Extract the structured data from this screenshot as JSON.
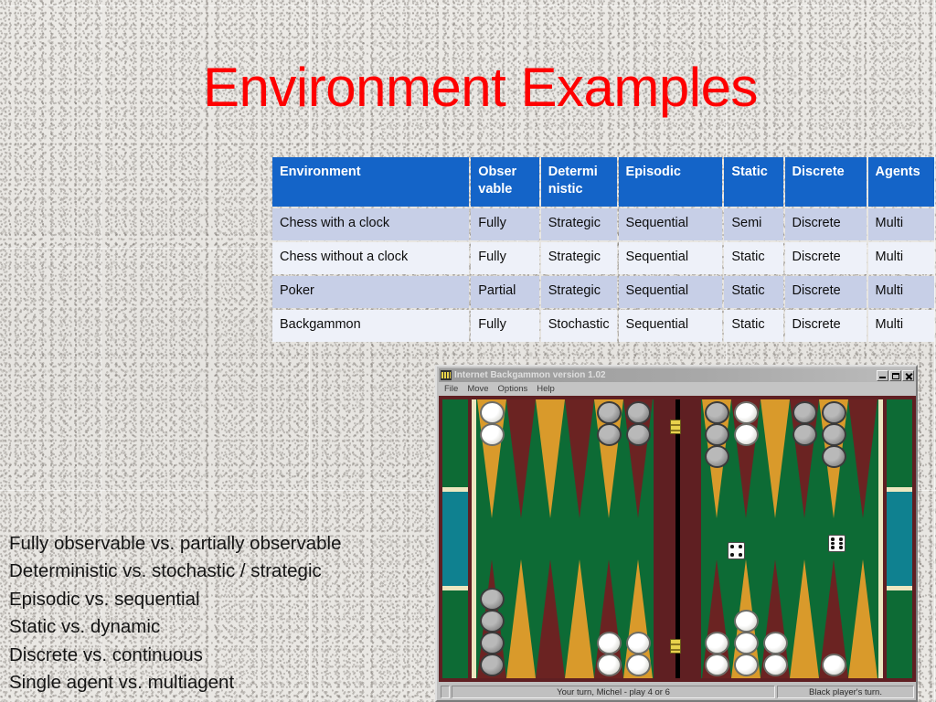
{
  "slide": {
    "title": "Environment Examples",
    "title_color": "#fe0000"
  },
  "table": {
    "header_bg": "#1464c8",
    "row_odd_bg": "#c7cfe7",
    "row_even_bg": "#eef1f9",
    "columns": [
      "Environment",
      "Obser vable",
      "Determi nistic",
      "Episodic",
      "Static",
      "Discrete",
      "Agents"
    ],
    "rows": [
      {
        "environment": "Chess with a clock",
        "observable": "Fully",
        "deterministic": "Strategic",
        "episodic": "Sequential",
        "static": "Semi",
        "discrete": "Discrete",
        "agents": "Multi"
      },
      {
        "environment": "Chess without a clock",
        "observable": "Fully",
        "deterministic": "Strategic",
        "episodic": "Sequential",
        "static": "Static",
        "discrete": "Discrete",
        "agents": "Multi"
      },
      {
        "environment": "Poker",
        "observable": "Partial",
        "deterministic": "Strategic",
        "episodic": "Sequential",
        "static": "Static",
        "discrete": "Discrete",
        "agents": "Multi"
      },
      {
        "environment": "Backgammon",
        "observable": "Fully",
        "deterministic": "Stochastic",
        "episodic": "Sequential",
        "static": "Static",
        "discrete": "Discrete",
        "agents": "Multi"
      }
    ]
  },
  "bullets": [
    "Fully observable vs. partially observable",
    "Deterministic vs. stochastic / strategic",
    "Episodic vs. sequential",
    "Static vs. dynamic",
    "Discrete vs. continuous",
    "Single agent vs. multiagent"
  ],
  "game_window": {
    "title": "Internet Backgammon version 1.02",
    "icon": "backgammon-icon",
    "window_buttons": {
      "minimize": "minimize-icon",
      "maximize": "maximize-icon",
      "close": "close-icon"
    },
    "menu": [
      "File",
      "Move",
      "Options",
      "Help"
    ],
    "status_left": "Your turn, Michel - play 4 or 6",
    "status_right": "Black player's turn.",
    "dice": [
      4,
      6
    ],
    "colors": {
      "felt": "#0d6b35",
      "frame": "#5f1f22",
      "point_light": "#d99a2b",
      "point_dark": "#6b2322",
      "tray_teal": "#0f8190",
      "divider": "#ece7c0"
    },
    "points": {
      "top_left": [
        {
          "color": "light",
          "checkers": 2,
          "piece": "white"
        },
        {
          "color": "dark",
          "checkers": 0,
          "piece": ""
        },
        {
          "color": "light",
          "checkers": 0,
          "piece": ""
        },
        {
          "color": "dark",
          "checkers": 0,
          "piece": ""
        },
        {
          "color": "light",
          "checkers": 2,
          "piece": "gray"
        },
        {
          "color": "dark",
          "checkers": 2,
          "piece": "gray"
        }
      ],
      "top_right": [
        {
          "color": "light",
          "checkers": 3,
          "piece": "gray"
        },
        {
          "color": "dark",
          "checkers": 2,
          "piece": "white"
        },
        {
          "color": "light",
          "checkers": 0,
          "piece": ""
        },
        {
          "color": "dark",
          "checkers": 2,
          "piece": "gray"
        },
        {
          "color": "light",
          "checkers": 3,
          "piece": "gray"
        },
        {
          "color": "dark",
          "checkers": 0,
          "piece": ""
        }
      ],
      "bottom_left": [
        {
          "color": "dark",
          "checkers": 4,
          "piece": "gray"
        },
        {
          "color": "light",
          "checkers": 0,
          "piece": ""
        },
        {
          "color": "dark",
          "checkers": 0,
          "piece": ""
        },
        {
          "color": "light",
          "checkers": 0,
          "piece": ""
        },
        {
          "color": "dark",
          "checkers": 2,
          "piece": "white"
        },
        {
          "color": "light",
          "checkers": 2,
          "piece": "white"
        }
      ],
      "bottom_right": [
        {
          "color": "dark",
          "checkers": 2,
          "piece": "white"
        },
        {
          "color": "light",
          "checkers": 3,
          "piece": "white"
        },
        {
          "color": "dark",
          "checkers": 2,
          "piece": "white"
        },
        {
          "color": "light",
          "checkers": 0,
          "piece": ""
        },
        {
          "color": "dark",
          "checkers": 1,
          "piece": "white"
        },
        {
          "color": "light",
          "checkers": 0,
          "piece": ""
        }
      ]
    }
  }
}
